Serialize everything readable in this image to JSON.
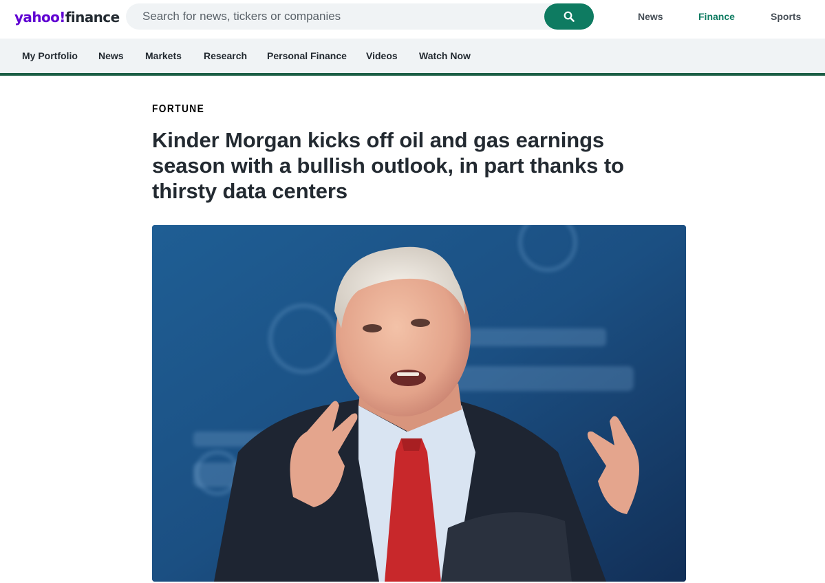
{
  "header": {
    "logo_part1": "yahoo!",
    "logo_part2": "finance",
    "search_placeholder": "Search for news, tickers or companies",
    "search_icon": "search-icon",
    "links": [
      {
        "label": "News",
        "active": false
      },
      {
        "label": "Finance",
        "active": true
      },
      {
        "label": "Sports",
        "active": false
      }
    ]
  },
  "subnav": {
    "items": [
      "My Portfolio",
      "News",
      "Markets",
      "Research",
      "Personal Finance",
      "Videos",
      "Watch Now"
    ]
  },
  "article": {
    "source": "FORTUNE",
    "headline": "Kinder Morgan kicks off oil and gas earnings season with a bullish outlook, in part thanks to thirsty data centers"
  },
  "colors": {
    "brand_purple": "#6001d2",
    "accent_green": "#0e7b61",
    "rule_green": "#1b5e45",
    "nav_background": "#f0f3f5"
  }
}
